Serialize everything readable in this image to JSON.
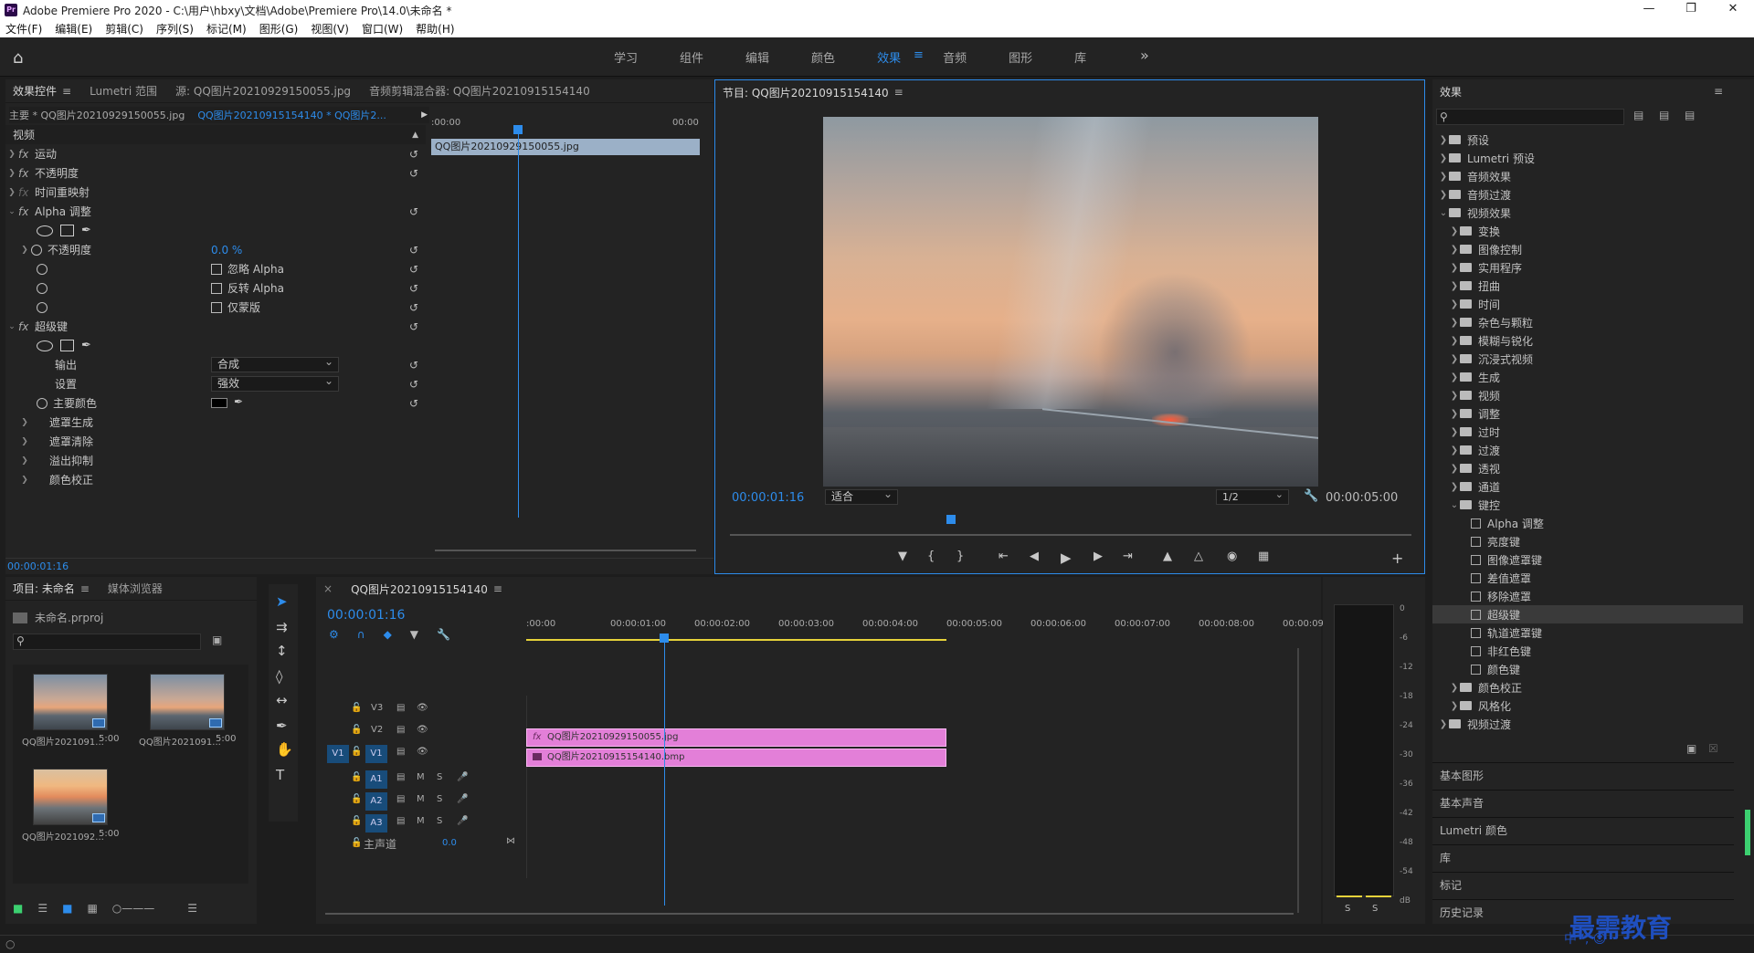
{
  "window": {
    "title": "Adobe Premiere Pro 2020 - C:\\用户\\hbxy\\文档\\Adobe\\Premiere Pro\\14.0\\未命名 *",
    "app_badge": "Pr"
  },
  "menu": [
    "文件(F)",
    "编辑(E)",
    "剪辑(C)",
    "序列(S)",
    "标记(M)",
    "图形(G)",
    "视图(V)",
    "窗口(W)",
    "帮助(H)"
  ],
  "workspaces": {
    "items": [
      "学习",
      "组件",
      "编辑",
      "颜色",
      "效果",
      "音频",
      "图形",
      "库"
    ],
    "active": "效果"
  },
  "effect_controls": {
    "tabs": [
      "效果控件",
      "Lumetri 范围",
      "源: QQ图片20210929150055.jpg",
      "音频剪辑混合器: QQ图片20210915154140"
    ],
    "master_clip": "主要 * QQ图片20210929150055.jpg",
    "seq_clip": "QQ图片20210915154140 * QQ图片2...",
    "ruler_start": ":00:00",
    "ruler_end": "00:00",
    "clip_bar": "QQ图片20210929150055.jpg",
    "section": "视频",
    "rows": {
      "motion": "运动",
      "opacity": "不透明度",
      "time_remap": "时间重映射",
      "alpha_adjust": "Alpha 调整",
      "alpha_opacity": "不透明度",
      "alpha_opacity_val": "0.0 %",
      "ignore_alpha": "忽略 Alpha",
      "invert_alpha": "反转 Alpha",
      "mask_only": "仅蒙版",
      "ultra_key": "超级键",
      "output": "输出",
      "output_val": "合成",
      "setting": "设置",
      "setting_val": "强效",
      "key_color": "主要颜色",
      "matte_gen": "遮罩生成",
      "matte_cleanup": "遮罩清除",
      "spill": "溢出抑制",
      "color_corr": "颜色校正"
    },
    "timecode": "00:00:01:16"
  },
  "program": {
    "title": "节目: QQ图片20210915154140",
    "timecode": "00:00:01:16",
    "fit": "适合",
    "res": "1/2",
    "duration": "00:00:05:00"
  },
  "effects": {
    "title": "效果",
    "search_placeholder": "",
    "tree": [
      {
        "label": "预设",
        "depth": 0,
        "type": "folder"
      },
      {
        "label": "Lumetri 预设",
        "depth": 0,
        "type": "folder"
      },
      {
        "label": "音频效果",
        "depth": 0,
        "type": "folder"
      },
      {
        "label": "音频过渡",
        "depth": 0,
        "type": "folder"
      },
      {
        "label": "视频效果",
        "depth": 0,
        "type": "folder",
        "open": true
      },
      {
        "label": "变换",
        "depth": 1,
        "type": "folder"
      },
      {
        "label": "图像控制",
        "depth": 1,
        "type": "folder"
      },
      {
        "label": "实用程序",
        "depth": 1,
        "type": "folder"
      },
      {
        "label": "扭曲",
        "depth": 1,
        "type": "folder"
      },
      {
        "label": "时间",
        "depth": 1,
        "type": "folder"
      },
      {
        "label": "杂色与颗粒",
        "depth": 1,
        "type": "folder"
      },
      {
        "label": "模糊与锐化",
        "depth": 1,
        "type": "folder"
      },
      {
        "label": "沉浸式视频",
        "depth": 1,
        "type": "folder"
      },
      {
        "label": "生成",
        "depth": 1,
        "type": "folder"
      },
      {
        "label": "视频",
        "depth": 1,
        "type": "folder"
      },
      {
        "label": "调整",
        "depth": 1,
        "type": "folder"
      },
      {
        "label": "过时",
        "depth": 1,
        "type": "folder"
      },
      {
        "label": "过渡",
        "depth": 1,
        "type": "folder"
      },
      {
        "label": "透视",
        "depth": 1,
        "type": "folder"
      },
      {
        "label": "通道",
        "depth": 1,
        "type": "folder"
      },
      {
        "label": "键控",
        "depth": 1,
        "type": "folder",
        "open": true
      },
      {
        "label": "Alpha 调整",
        "depth": 2,
        "type": "effect"
      },
      {
        "label": "亮度键",
        "depth": 2,
        "type": "effect"
      },
      {
        "label": "图像遮罩键",
        "depth": 2,
        "type": "effect"
      },
      {
        "label": "差值遮罩",
        "depth": 2,
        "type": "effect"
      },
      {
        "label": "移除遮罩",
        "depth": 2,
        "type": "effect"
      },
      {
        "label": "超级键",
        "depth": 2,
        "type": "effect",
        "selected": true
      },
      {
        "label": "轨道遮罩键",
        "depth": 2,
        "type": "effect"
      },
      {
        "label": "非红色键",
        "depth": 2,
        "type": "effect"
      },
      {
        "label": "颜色键",
        "depth": 2,
        "type": "effect"
      },
      {
        "label": "颜色校正",
        "depth": 1,
        "type": "folder"
      },
      {
        "label": "风格化",
        "depth": 1,
        "type": "folder"
      },
      {
        "label": "视频过渡",
        "depth": 0,
        "type": "folder"
      }
    ],
    "sections": [
      "基本图形",
      "基本声音",
      "Lumetri 颜色",
      "库",
      "标记",
      "历史记录"
    ]
  },
  "project": {
    "tabs": [
      "项目: 未命名",
      "媒体浏览器"
    ],
    "file": "未命名.prproj",
    "items": [
      {
        "name": "QQ图片2021091...",
        "dur": "5:00"
      },
      {
        "name": "QQ图片2021091...",
        "dur": "5:00"
      },
      {
        "name": "QQ图片2021092...",
        "dur": "5:00"
      }
    ]
  },
  "timeline": {
    "title": "QQ图片20210915154140",
    "timecode": "00:00:01:16",
    "ruler": [
      ":00:00",
      "00:00:01:00",
      "00:00:02:00",
      "00:00:03:00",
      "00:00:04:00",
      "00:00:05:00",
      "00:00:06:00",
      "00:00:07:00",
      "00:00:08:00",
      "00:00:09:"
    ],
    "tracks_video": [
      "V3",
      "V2",
      "V1"
    ],
    "tracks_audio": [
      "A1",
      "A2",
      "A3"
    ],
    "src_v": "V1",
    "master": "主声道",
    "master_val": "0.0",
    "mute": "M",
    "solo": "S",
    "clip_v2": "QQ图片20210929150055.jpg",
    "clip_v1": "QQ图片20210915154140.bmp",
    "clip_v2_fx": "fx"
  },
  "audio_meter": {
    "labels": [
      "0",
      "-6",
      "-12",
      "-18",
      "-24",
      "-30",
      "-36",
      "-42",
      "-48",
      "-54",
      "dB"
    ],
    "solo": "S"
  },
  "overlay": {
    "watermark": "最需教育",
    "ime": "中 ‘, ☺"
  },
  "colors": {
    "accent": "#2d8ceb",
    "clip": "#e37fd8",
    "panel": "#232323"
  }
}
